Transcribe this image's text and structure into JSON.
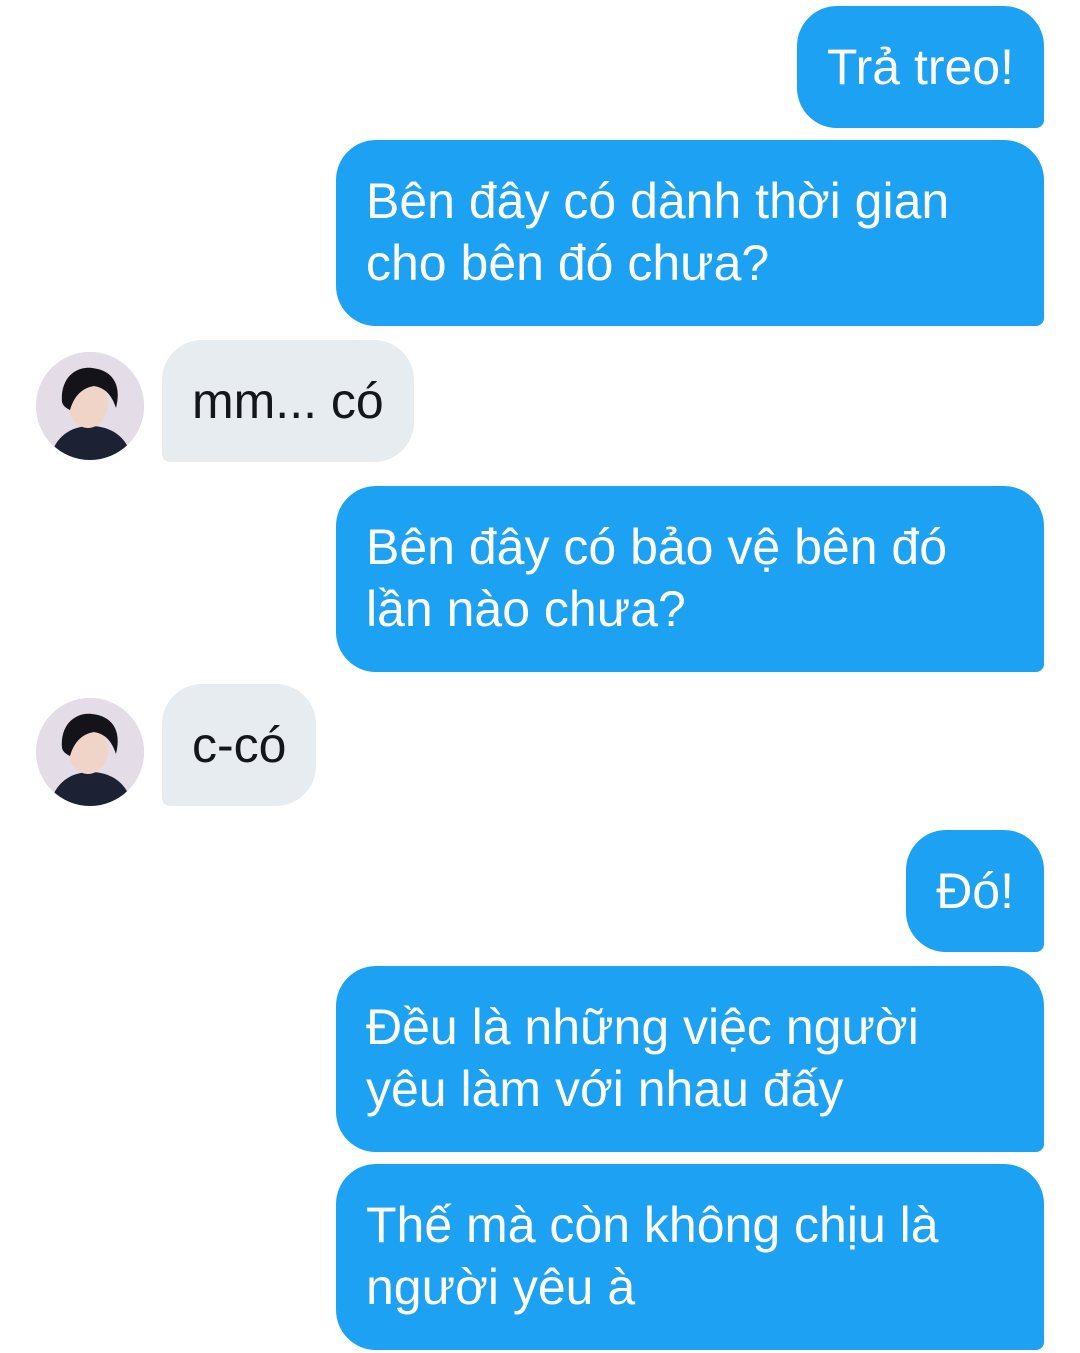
{
  "conversation": {
    "messages": [
      {
        "from": "me",
        "lines": [
          "Trả treo!"
        ]
      },
      {
        "from": "me",
        "lines": [
          "Bên đây có dành thời gian",
          "cho bên đó chưa?"
        ]
      },
      {
        "from": "them",
        "lines": [
          "mm... có"
        ]
      },
      {
        "from": "me",
        "lines": [
          "Bên đây có bảo vệ bên đó",
          "lần nào chưa?"
        ]
      },
      {
        "from": "them",
        "lines": [
          "c-có"
        ]
      },
      {
        "from": "me",
        "lines": [
          "Đó!"
        ]
      },
      {
        "from": "me",
        "lines": [
          "Đều là những việc người",
          "yêu làm với nhau đấy"
        ]
      },
      {
        "from": "me",
        "lines": [
          "Thế mà còn không chịu là",
          "người yêu à"
        ]
      }
    ]
  },
  "colors": {
    "sent_bubble": "#1da1f2",
    "received_bubble": "#e6ecf0",
    "background": "#ffffff"
  },
  "icons": {
    "contact_avatar": "user-avatar-photo"
  }
}
